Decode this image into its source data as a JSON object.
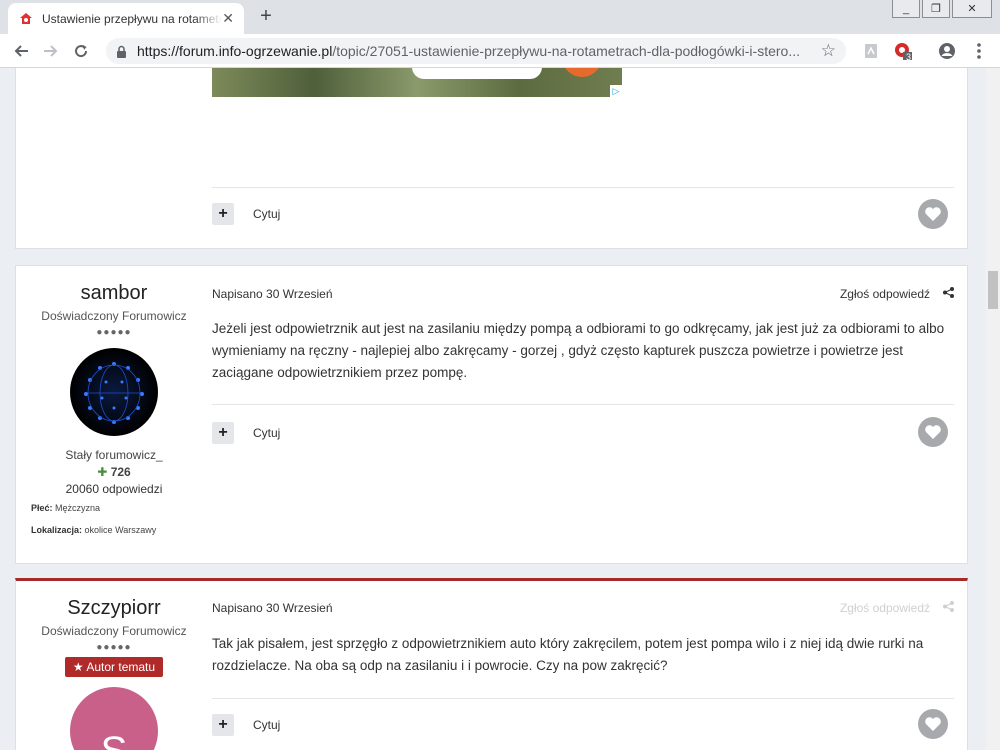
{
  "browser": {
    "tab_title": "Ustawienie przepływu na rotametrach dla podłogówki i sterowanie",
    "tab_close": "✕",
    "new_tab": "+",
    "url_host": "https://forum.info-ogrzewanie.pl",
    "url_path": "/topic/27051-ustawienie-przepływu-na-rotametrach-dla-podłogówki-i-stero...",
    "extension_badge": "3",
    "win_minimize": "_",
    "win_restore": "❐",
    "win_close": "✕"
  },
  "posts": [
    {
      "quote_label": "Cytuj",
      "add_label": "+"
    },
    {
      "author": "sambor",
      "rank": "Doświadczony Forumowicz",
      "pips": "●●●●●",
      "group": "Stały forumowicz_",
      "reputation_sign": "✚",
      "reputation": "726",
      "replies": "20060 odpowiedzi",
      "gender_label": "Płeć:",
      "gender": "Mężczyzna",
      "location_label": "Lokalizacja:",
      "location": "okolice Warszawy",
      "date": "Napisano 30 Wrzesień",
      "report": "Zgłoś odpowiedź",
      "text": "Jeżeli jest odpowietrznik aut jest na zasilaniu między pompą a odbiorami to go odkręcamy, jak jest już za odbiorami to albo wymieniamy na ręczny - najlepiej albo zakręcamy - gorzej , gdyż często kapturek puszcza powietrze i  powietrze  jest zaciągane odpowietrznikiem przez pompę.",
      "quote_label": "Cytuj",
      "add_label": "+"
    },
    {
      "author": "Szczypiorr",
      "rank": "Doświadczony Forumowicz",
      "pips": "●●●●●",
      "op_badge": "Autor tematu",
      "avatar_letter": "S",
      "date": "Napisano 30 Wrzesień",
      "report": "Zgłoś odpowiedź",
      "text": "Tak jak pisałem, jest sprzęgło z odpowietrznikiem auto który zakręcilem, potem jest pompa wilo i z niej idą dwie rurki na rozdzielacze. Na oba są odp na zasilaniu i i powrocie. Czy na pow zakręcić?",
      "quote_label": "Cytuj",
      "add_label": "+"
    }
  ],
  "colors": {
    "accent_red": "#b02a2a",
    "rep_green": "#4b8d3a"
  }
}
